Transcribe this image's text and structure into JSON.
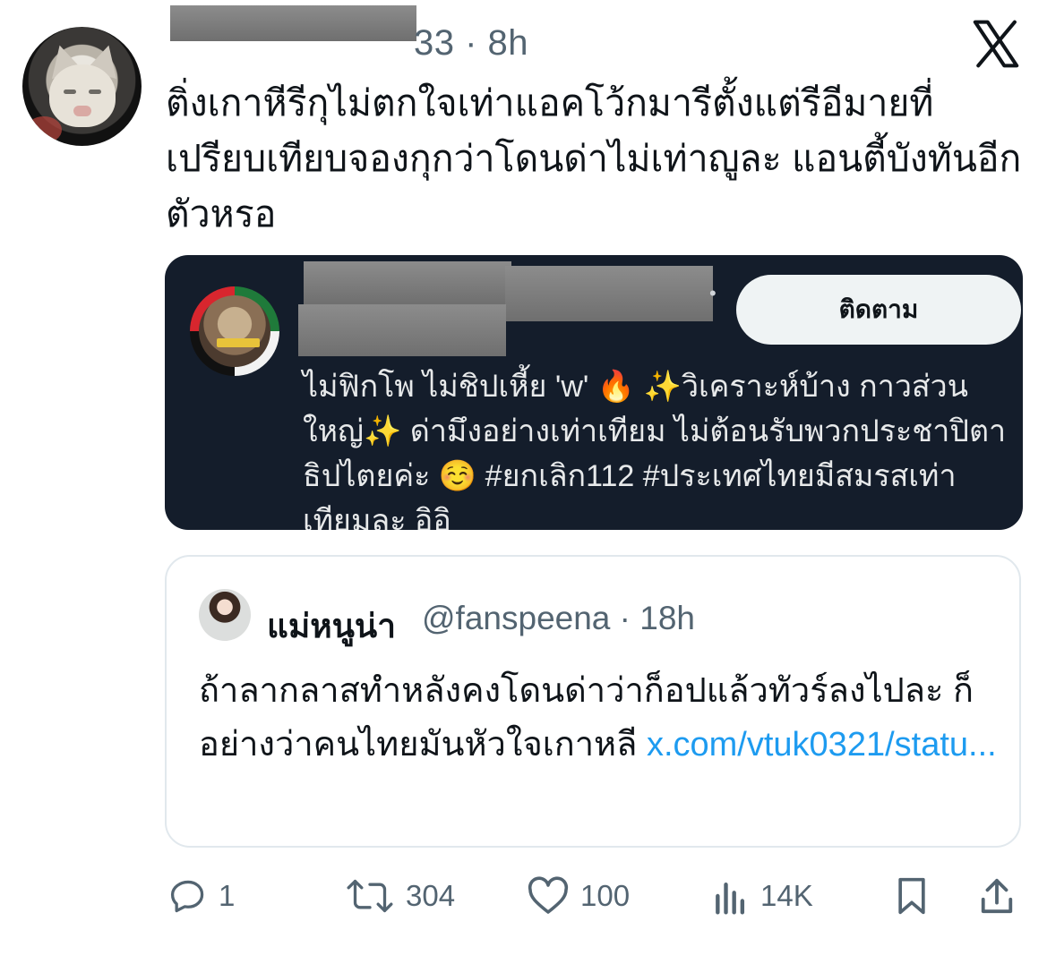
{
  "post": {
    "handle_tail": "33",
    "time": "8h",
    "text": "ติ่งเกาหีรีกุไม่ตกใจเท่าแอคโว้กมารีตั้งแต่รีอีมายที่เปรียบเทียบจองกุกว่าโดนด่าไม่เท่าญูละ แอนตี้บังทันอีกตัวหรอ"
  },
  "card": {
    "follow_label": "ติดตาม",
    "bio": "ไม่ฟิกโพ ไม่ชิปเหี้ย 'w' 🔥 ✨วิเคราะห์บ้าง กาวส่วนใหญ่✨ ด่ามึงอย่างเท่าเทียม ไม่ต้อนรับพวกประชาปิตาธิปไตยค่ะ ☺️ #ยกเลิก112 #ประเทศไทยมีสมรสเท่าเทียมละ อิอิ"
  },
  "quote": {
    "name": "แม่หนูน่า",
    "handle": "@fanspeena",
    "time": "18h",
    "text": "ถ้าลากลาสทำหลังคงโดนด่าว่าก็อปแล้วทัวร์ลงไปละ ก็อย่างว่าคนไทยมันหัวใจเกาหลี",
    "link": "x.com/vtuk0321/statu..."
  },
  "actions": {
    "replies": "1",
    "reposts": "304",
    "likes": "100",
    "views": "14K"
  },
  "icons": [
    "x-logo-icon",
    "reply-icon",
    "repost-icon",
    "like-icon",
    "views-icon",
    "bookmark-icon",
    "share-icon"
  ],
  "colors": {
    "text": "#0f1419",
    "muted": "#536471",
    "link": "#1d9bf0",
    "card_bg": "#141d2b"
  }
}
